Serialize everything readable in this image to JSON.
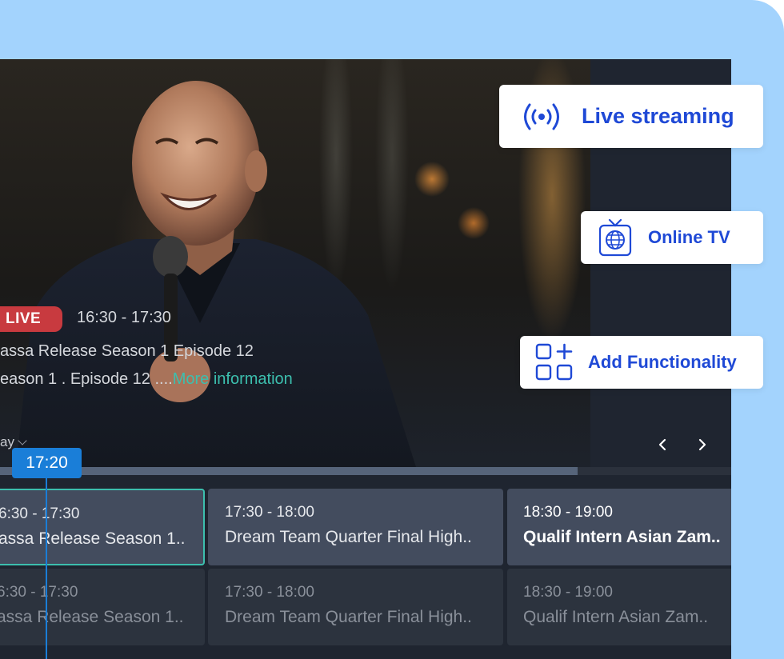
{
  "player": {
    "live_badge": "LIVE",
    "time_range": "16:30 - 17:30",
    "title": "assa Release Season 1 Episode 12",
    "subtitle": "eason 1 .  Episode 12 ....",
    "more_link": "More information"
  },
  "guide": {
    "day_label": "ay",
    "current_time": "17:20",
    "timeline_progress": 0.79,
    "rows": [
      [
        {
          "time": "6:30 - 17:30",
          "title": "assa Release Season 1.."
        },
        {
          "time": "17:30 - 18:00",
          "title": "Dream Team Quarter Final High.."
        },
        {
          "time": "18:30 - 19:00",
          "title": "Qualif Intern Asian Zam.."
        }
      ],
      [
        {
          "time": "6:30 - 17:30",
          "title": "assa Release Season 1.."
        },
        {
          "time": "17:30 - 18:00",
          "title": "Dream Team Quarter Final High.."
        },
        {
          "time": "18:30 - 19:00",
          "title": "Qualif Intern Asian Zam.."
        }
      ]
    ]
  },
  "callouts": {
    "live_streaming": "Live streaming",
    "online_tv": "Online TV",
    "add_functionality": "Add Functionality"
  },
  "icons": {
    "broadcast": "broadcast-icon",
    "tv_globe": "tv-globe-icon",
    "grid_add": "grid-add-icon",
    "prev": "chevron-left-icon",
    "next": "chevron-right-icon",
    "dropdown": "chevron-down-icon"
  },
  "colors": {
    "background": "#a3d3fd",
    "accent_blue": "#1f49d6",
    "live_red": "#c83a3f",
    "teal": "#3cbfae",
    "time_indicator": "#1a7ed8",
    "screen_bg": "#1f2530"
  }
}
